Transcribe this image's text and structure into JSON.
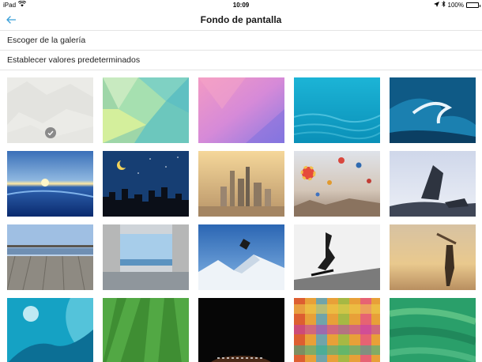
{
  "status_bar": {
    "device": "iPad",
    "time": "10:09",
    "battery_percent": "100%",
    "battery_level": 1.0,
    "icons": [
      "wifi-icon",
      "location-arrow-icon",
      "bluetooth-icon",
      "battery-icon"
    ]
  },
  "nav": {
    "title": "Fondo de pantalla",
    "back_icon": "arrow-left-icon",
    "accent_color": "#3a9fd8"
  },
  "menu": {
    "choose_gallery": "Escoger de la galería",
    "restore_defaults": "Establecer valores predeterminados"
  },
  "wallpapers": [
    {
      "id": "light-texture",
      "selected": true
    },
    {
      "id": "green-polygon",
      "selected": false
    },
    {
      "id": "pink-purple-gradient",
      "selected": false
    },
    {
      "id": "turquoise-water",
      "selected": false
    },
    {
      "id": "ocean-wave",
      "selected": false
    },
    {
      "id": "sunset-ocean-underwater",
      "selected": false
    },
    {
      "id": "night-city-moon",
      "selected": false
    },
    {
      "id": "city-skyline-sunrise",
      "selected": false
    },
    {
      "id": "hot-air-balloons",
      "selected": false
    },
    {
      "id": "rocks-misty-water",
      "selected": false
    },
    {
      "id": "wooden-pier",
      "selected": false
    },
    {
      "id": "concrete-arch-sea",
      "selected": false
    },
    {
      "id": "snowboarder-mountains",
      "selected": false
    },
    {
      "id": "skateboarder-bw",
      "selected": false
    },
    {
      "id": "longboarder-sunset",
      "selected": false
    },
    {
      "id": "surfer-wave",
      "selected": false
    },
    {
      "id": "grass-field-stripes",
      "selected": false
    },
    {
      "id": "football-dark",
      "selected": false
    },
    {
      "id": "colorful-plaid",
      "selected": false
    },
    {
      "id": "green-paint-strokes",
      "selected": false
    }
  ],
  "selected_check_icon": "checkmark-icon"
}
